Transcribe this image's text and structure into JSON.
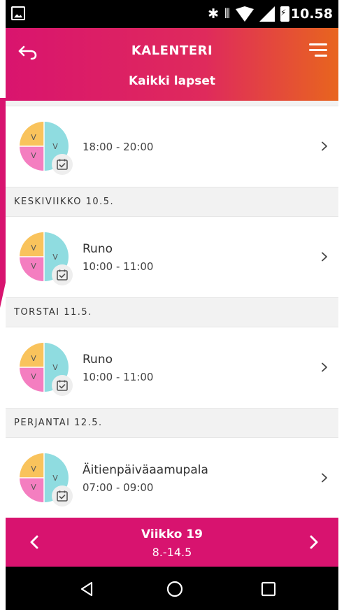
{
  "status_bar": {
    "time": "10.58",
    "icons": [
      "image-icon",
      "bluetooth-icon",
      "vibrate-icon",
      "wifi-icon",
      "cell-signal-icon",
      "battery-charging-icon"
    ]
  },
  "header": {
    "title": "KALENTERI",
    "subtitle": "Kaikki lapset",
    "gradient_colors": [
      "#d9146e",
      "#e8651e"
    ]
  },
  "events": [
    {
      "name": "",
      "time": "18:00 - 20:00",
      "avatar_letters": [
        "V",
        "V",
        "V"
      ]
    },
    {
      "day_label": "KESKIVIIKKO 10.5.",
      "name": "Runo",
      "time": "10:00 - 11:00",
      "avatar_letters": [
        "V",
        "V",
        "V"
      ]
    },
    {
      "day_label": "TORSTAI 11.5.",
      "name": "Runo",
      "time": "10:00 - 11:00",
      "avatar_letters": [
        "V",
        "V",
        "V"
      ]
    },
    {
      "day_label": "PERJANTAI 12.5.",
      "name": "Äitienpäiväaamupala",
      "time": "07:00 - 09:00",
      "avatar_letters": [
        "V",
        "V",
        "V"
      ]
    }
  ],
  "avatar_colors": {
    "top_left": "#f9c35c",
    "bottom_left": "#f47ec0",
    "right": "#8fdce0"
  },
  "week_bar": {
    "week_label": "Viikko 19",
    "date_range": "8.-14.5",
    "color": "#d8136f"
  },
  "nav_bar": {
    "buttons": [
      "back-triangle-icon",
      "home-circle-icon",
      "recents-square-icon"
    ]
  }
}
